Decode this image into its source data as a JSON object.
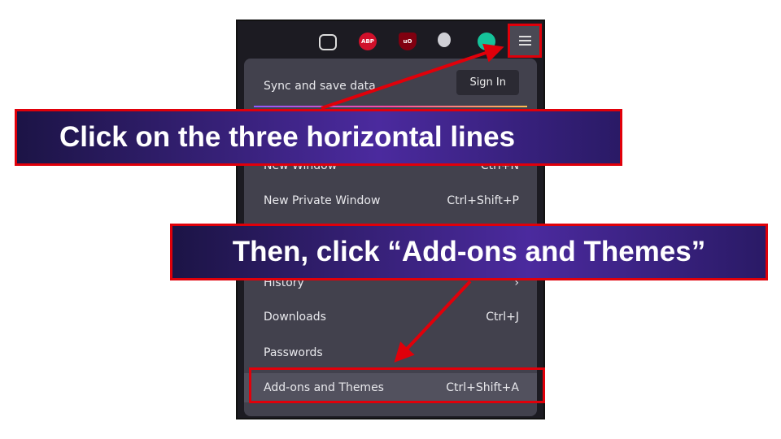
{
  "toolbar": {
    "icons": [
      "pocket-icon",
      "adblock-plus-icon",
      "ublock-origin-icon",
      "extension-icon",
      "grammarly-icon"
    ],
    "abp": "ABP",
    "ub": "uO",
    "menu_icon": "hamburger-menu-icon"
  },
  "menu": {
    "sync_label": "Sync and save data",
    "sign_in": "Sign In",
    "items": [
      {
        "label": "New Window",
        "shortcut": "Ctrl+N"
      },
      {
        "label": "New Private Window",
        "shortcut": "Ctrl+Shift+P"
      },
      {
        "label": "History",
        "shortcut": "›"
      },
      {
        "label": "Downloads",
        "shortcut": "Ctrl+J"
      },
      {
        "label": "Passwords",
        "shortcut": ""
      },
      {
        "label": "Add-ons and Themes",
        "shortcut": "Ctrl+Shift+A"
      }
    ]
  },
  "annotations": {
    "step1": "Click on the three horizontal lines",
    "step2": "Then, click “Add-ons and Themes”"
  },
  "colors": {
    "highlight": "#e0000a",
    "panel": "#42414d"
  }
}
